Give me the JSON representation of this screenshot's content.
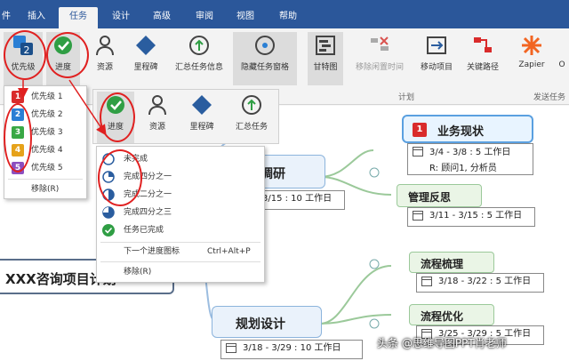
{
  "tabs": [
    {
      "label": "件"
    },
    {
      "label": "插入"
    },
    {
      "label": "任务"
    },
    {
      "label": "设计"
    },
    {
      "label": "高级"
    },
    {
      "label": "审阅"
    },
    {
      "label": "视图"
    },
    {
      "label": "帮助"
    }
  ],
  "ribbon": {
    "buttons": [
      {
        "label": "优先级"
      },
      {
        "label": "进度"
      },
      {
        "label": "资源"
      },
      {
        "label": "里程碑"
      },
      {
        "label": "汇总任务信息"
      },
      {
        "label": "隐藏任务窗格"
      },
      {
        "label": "甘特图"
      },
      {
        "label": "移除闲置时间"
      },
      {
        "label": "移动项目"
      },
      {
        "label": "关键路径"
      },
      {
        "label": "Zapier"
      },
      {
        "label": "O"
      }
    ],
    "groups": {
      "plan": "计划",
      "send": "发送任务"
    },
    "second_row": [
      "进度",
      "资源",
      "里程碑",
      "汇总任务"
    ]
  },
  "priority_menu": {
    "items": [
      {
        "num": "1",
        "label": "优先级 1",
        "color": "#d92b2b"
      },
      {
        "num": "2",
        "label": "优先级 2",
        "color": "#2a7fd4"
      },
      {
        "num": "3",
        "label": "优先级 3",
        "color": "#39a845"
      },
      {
        "num": "4",
        "label": "优先级 4",
        "color": "#e6a21a"
      },
      {
        "num": "5",
        "label": "优先级 5",
        "color": "#8c4fc0"
      }
    ],
    "remove": "移除(R)"
  },
  "progress_menu": {
    "items": [
      "未完成",
      "完成四分之一",
      "完成二分之一",
      "完成四分之三",
      "任务已完成"
    ],
    "next": "下一个进度图标",
    "shortcut": "Ctrl+Alt+P",
    "remove": "移除(R)"
  },
  "mindmap": {
    "root_title": "XXX咨询项目计划",
    "node_partial": "调研",
    "node_partial_info": "3/15 : 10 工作日",
    "business": {
      "badge": "1",
      "title": "业务现状",
      "dates": "3/4 - 3/8 : 5 工作日",
      "resource": "R: 顾问1, 分析员"
    },
    "feedback": {
      "title": "管理反思",
      "dates": "3/11 - 3/15 : 5 工作日"
    },
    "process_sort": {
      "title": "流程梳理",
      "dates": "3/18 - 3/22 : 5 工作日"
    },
    "process_opt": {
      "title": "流程优化",
      "dates": "3/25 - 3/29 : 5 工作日"
    },
    "plan": {
      "title": "规划设计",
      "dates": "3/18 - 3/29 : 10 工作日"
    }
  },
  "watermark": "头条 @思维导图PPT肖老师"
}
